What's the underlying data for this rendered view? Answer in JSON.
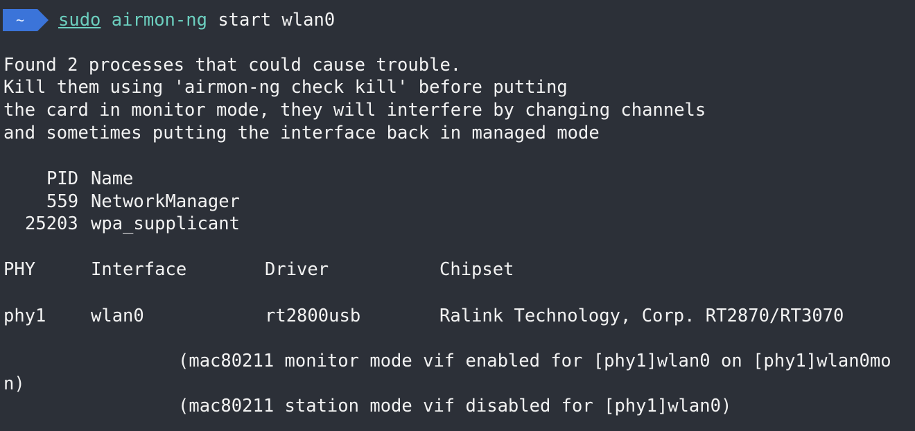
{
  "prompt": {
    "badge": "~",
    "sudo": "sudo",
    "program": "airmon-ng",
    "args": "start wlan0"
  },
  "warning": [
    "Found 2 processes that could cause trouble.",
    "Kill them using 'airmon-ng check kill' before putting",
    "the card in monitor mode, they will interfere by changing channels",
    "and sometimes putting the interface back in managed mode"
  ],
  "processes": {
    "headers": [
      "PID",
      "Name"
    ],
    "rows": [
      [
        "559",
        "NetworkManager"
      ],
      [
        "25203",
        "wpa_supplicant"
      ]
    ]
  },
  "interfaces": {
    "headers": [
      "PHY",
      "Interface",
      "Driver",
      "Chipset"
    ],
    "rows": [
      [
        "phy1",
        "wlan0",
        "rt2800usb",
        "Ralink Technology, Corp. RT2870/RT3070"
      ]
    ]
  },
  "messages": [
    "(mac80211 monitor mode vif enabled for [phy1]wlan0 on [phy1]wlan0mo",
    "n)",
    "(mac80211 station mode vif disabled for [phy1]wlan0)"
  ],
  "colors": {
    "background": "#2c3038",
    "prompt_badge": "#3b74d9",
    "command": "#6ccfbf",
    "text": "#f2f2f2"
  }
}
